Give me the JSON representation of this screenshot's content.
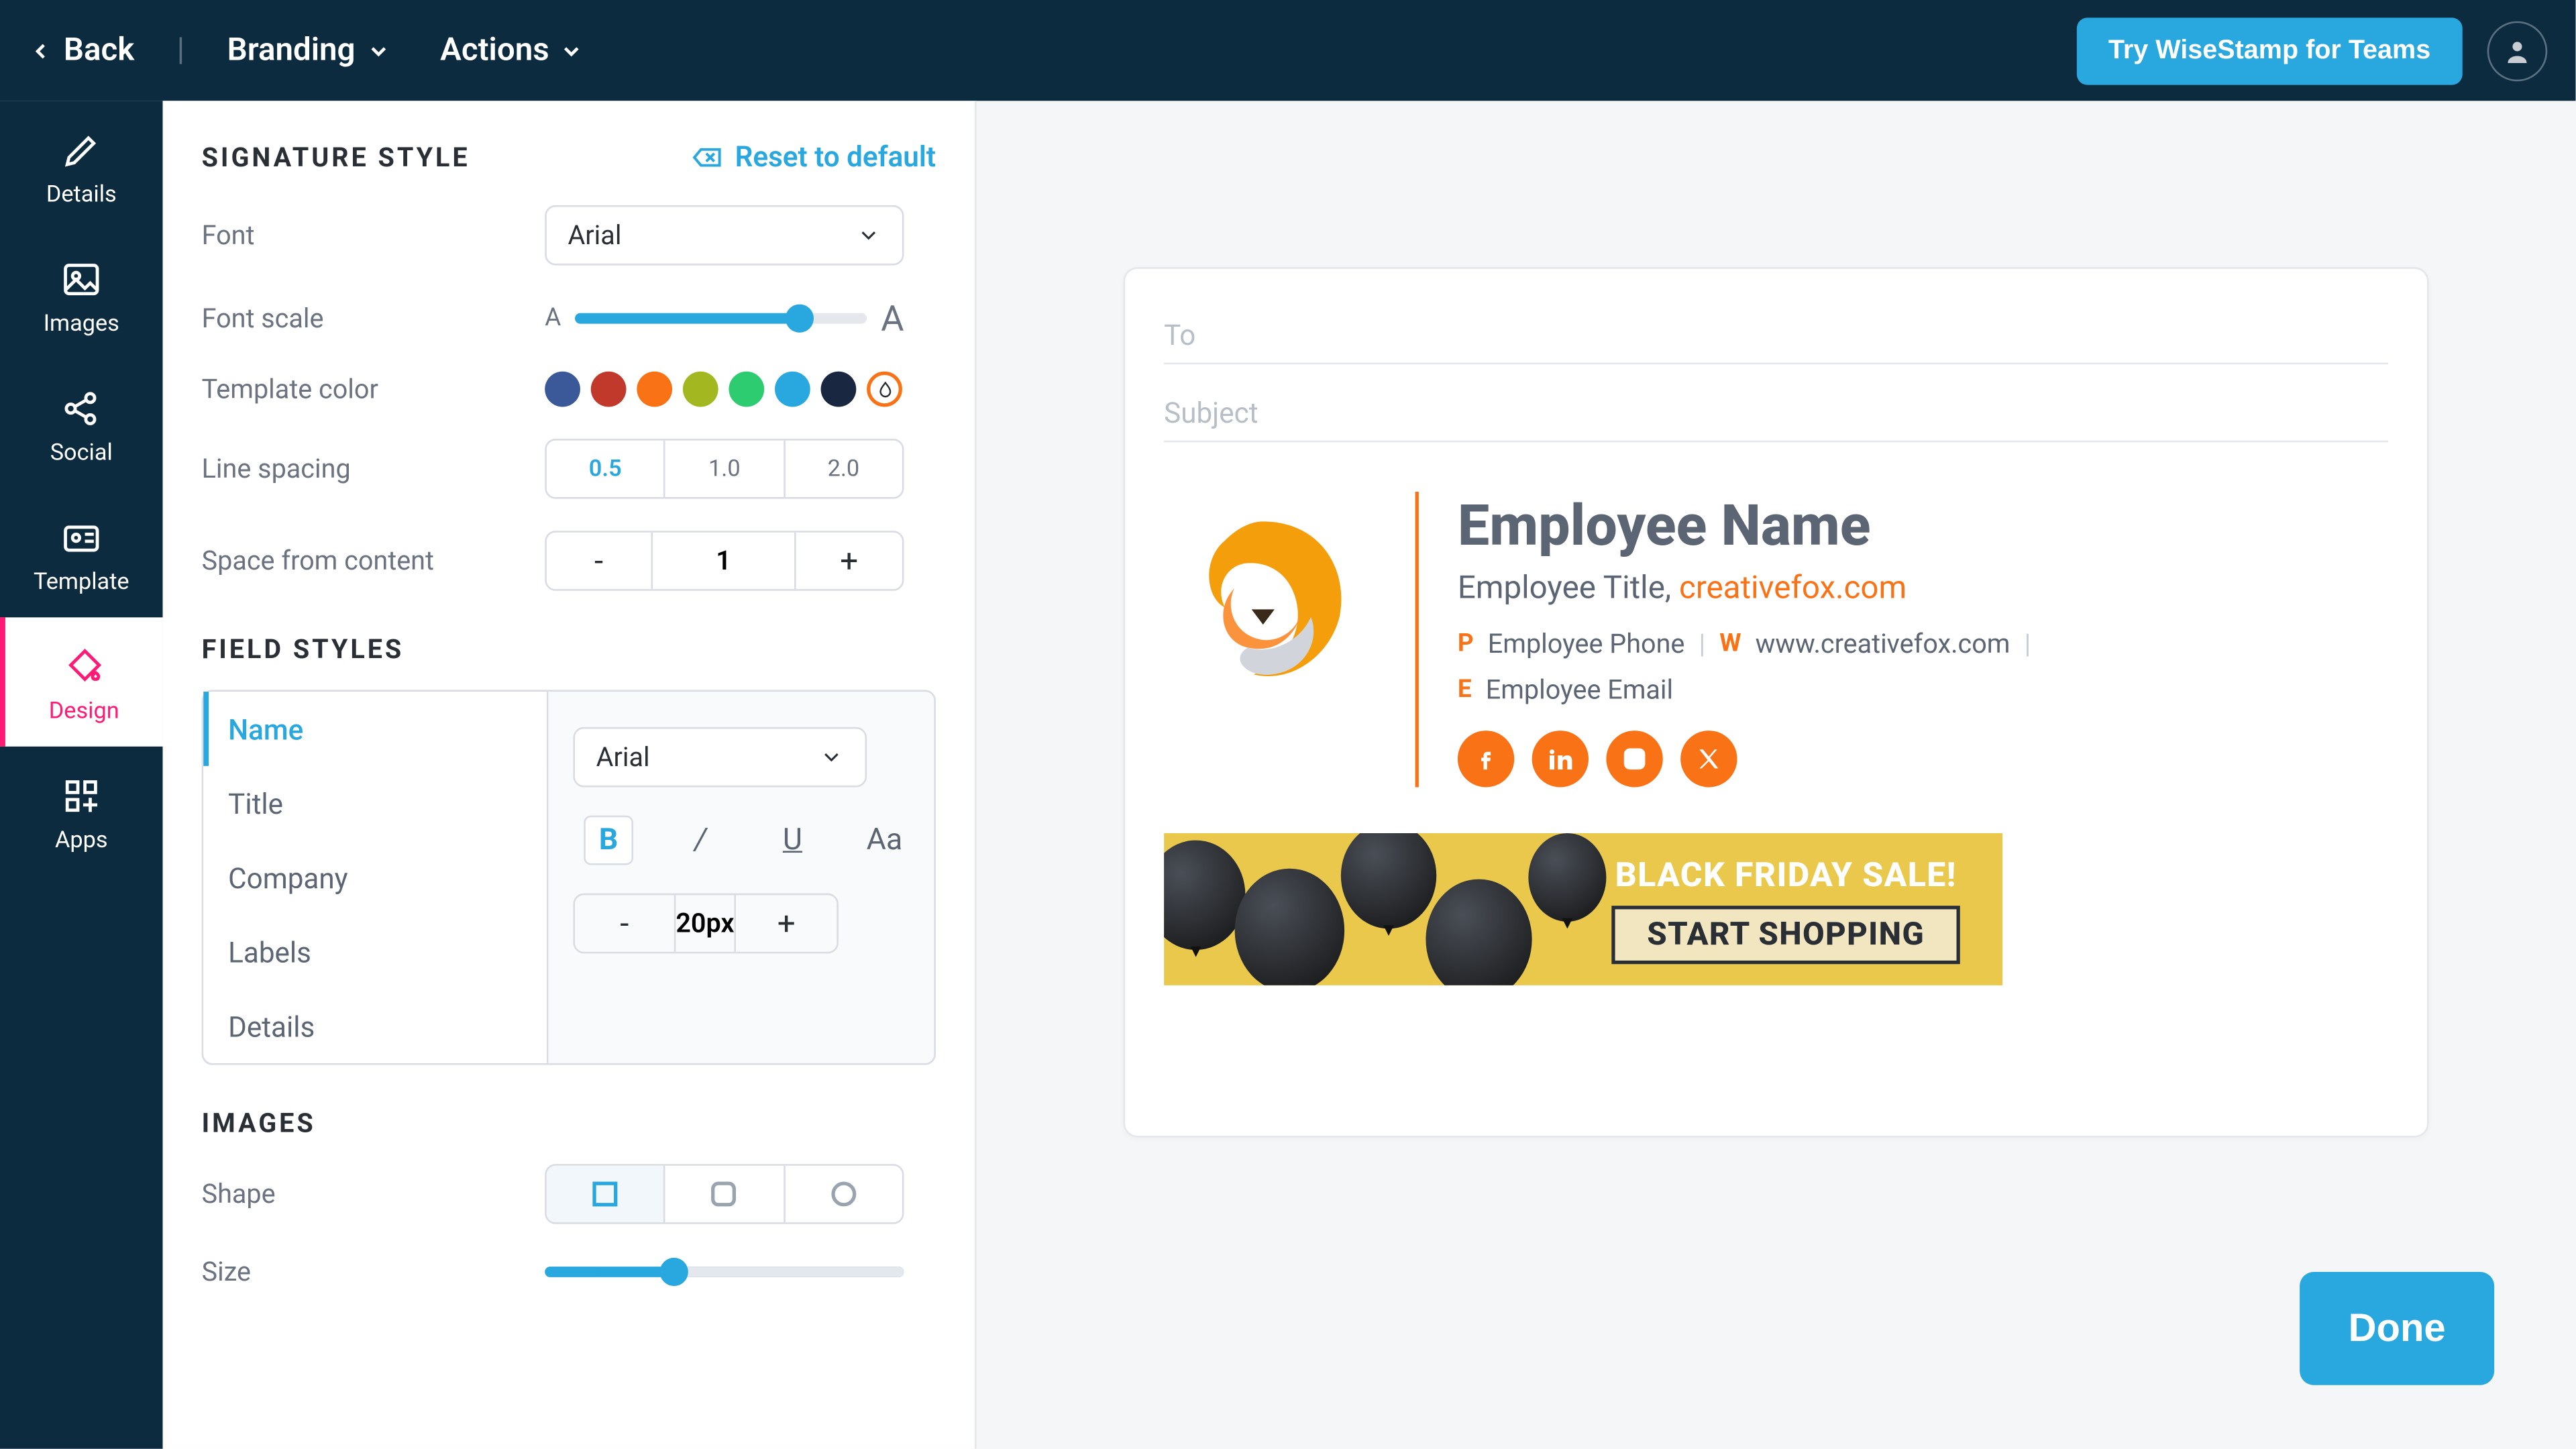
{
  "topbar": {
    "back": "Back",
    "branding": "Branding",
    "actions": "Actions",
    "teams": "Try WiseStamp for Teams"
  },
  "nav": {
    "details": "Details",
    "images": "Images",
    "social": "Social",
    "template": "Template",
    "design": "Design",
    "apps": "Apps"
  },
  "panel": {
    "sig_style": "SIGNATURE STYLE",
    "reset": "Reset to default",
    "font_label": "Font",
    "font_value": "Arial",
    "scale_label": "Font scale",
    "scale_small": "A",
    "scale_large": "A",
    "tcolor_label": "Template color",
    "colors": [
      "#3b5998",
      "#c0392b",
      "#f97316",
      "#a3b820",
      "#2ecc71",
      "#29a7df",
      "#1a2740"
    ],
    "lspace_label": "Line spacing",
    "lspace_opts": [
      "0.5",
      "1.0",
      "2.0"
    ],
    "lspace_active": "0.5",
    "spacec_label": "Space from content",
    "spacec_val": "1",
    "field_styles": "FIELD STYLES",
    "field_tabs": [
      "Name",
      "Title",
      "Company",
      "Labels",
      "Details"
    ],
    "field_active": "Name",
    "field_font": "Arial",
    "fmt_bold": "B",
    "fmt_italic": "/",
    "fmt_underline": "U",
    "fmt_case": "Aa",
    "field_size": "20px",
    "images_sec": "IMAGES",
    "shape_label": "Shape",
    "size_label": "Size"
  },
  "preview": {
    "to": "To",
    "subject": "Subject",
    "name": "Employee Name",
    "title": "Employee Title, ",
    "company": "creativefox.com",
    "phone_label": "P",
    "phone": "Employee Phone",
    "web_label": "W",
    "web": "www.creativefox.com",
    "email_label": "E",
    "email": "Employee Email",
    "banner_title": "BLACK FRIDAY SALE!",
    "banner_cta": "START SHOPPING"
  },
  "done": "Done"
}
